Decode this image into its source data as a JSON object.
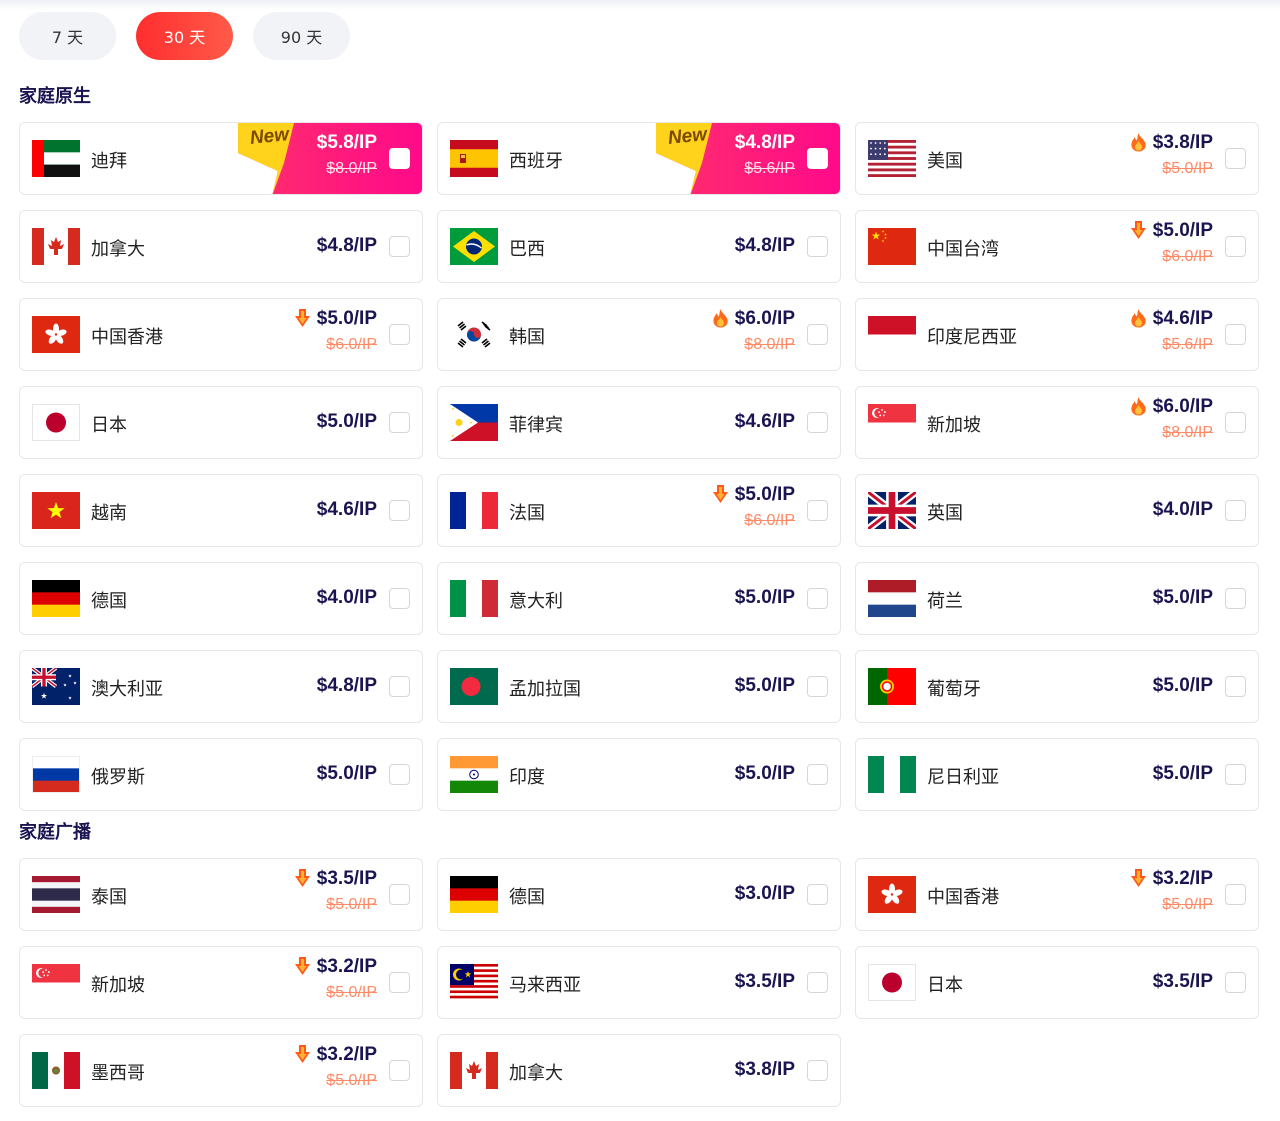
{
  "tabs": [
    {
      "label": "7 天",
      "active": false
    },
    {
      "label": "30 天",
      "active": true
    },
    {
      "label": "90 天",
      "active": false
    }
  ],
  "sections": [
    {
      "title": "家庭原生",
      "items": [
        {
          "flag": "ae",
          "country": "迪拜",
          "price": "$5.8/IP",
          "old_price": "$8.0/IP",
          "badge": "New",
          "selected": true
        },
        {
          "flag": "es",
          "country": "西班牙",
          "price": "$4.8/IP",
          "old_price": "$5.6/IP",
          "badge": "New",
          "selected": true
        },
        {
          "flag": "us",
          "country": "美国",
          "price": "$3.8/IP",
          "old_price": "$5.0/IP",
          "icon": "fire-icon"
        },
        {
          "flag": "ca",
          "country": "加拿大",
          "price": "$4.8/IP"
        },
        {
          "flag": "br",
          "country": "巴西",
          "price": "$4.8/IP"
        },
        {
          "flag": "tw",
          "country": "中国台湾",
          "price": "$5.0/IP",
          "old_price": "$6.0/IP",
          "icon": "price-drop-icon"
        },
        {
          "flag": "hk",
          "country": "中国香港",
          "price": "$5.0/IP",
          "old_price": "$6.0/IP",
          "icon": "price-drop-icon"
        },
        {
          "flag": "kr",
          "country": "韩国",
          "price": "$6.0/IP",
          "old_price": "$8.0/IP",
          "icon": "fire-icon"
        },
        {
          "flag": "id",
          "country": "印度尼西亚",
          "price": "$4.6/IP",
          "old_price": "$5.6/IP",
          "icon": "fire-icon"
        },
        {
          "flag": "jp",
          "country": "日本",
          "price": "$5.0/IP"
        },
        {
          "flag": "ph",
          "country": "菲律宾",
          "price": "$4.6/IP"
        },
        {
          "flag": "sg",
          "country": "新加坡",
          "price": "$6.0/IP",
          "old_price": "$8.0/IP",
          "icon": "fire-icon"
        },
        {
          "flag": "vn",
          "country": "越南",
          "price": "$4.6/IP"
        },
        {
          "flag": "fr",
          "country": "法国",
          "price": "$5.0/IP",
          "old_price": "$6.0/IP",
          "icon": "price-drop-icon"
        },
        {
          "flag": "gb",
          "country": "英国",
          "price": "$4.0/IP"
        },
        {
          "flag": "de",
          "country": "德国",
          "price": "$4.0/IP"
        },
        {
          "flag": "it",
          "country": "意大利",
          "price": "$5.0/IP"
        },
        {
          "flag": "nl",
          "country": "荷兰",
          "price": "$5.0/IP"
        },
        {
          "flag": "au",
          "country": "澳大利亚",
          "price": "$4.8/IP"
        },
        {
          "flag": "bd",
          "country": "孟加拉国",
          "price": "$5.0/IP"
        },
        {
          "flag": "pt",
          "country": "葡萄牙",
          "price": "$5.0/IP"
        },
        {
          "flag": "ru",
          "country": "俄罗斯",
          "price": "$5.0/IP"
        },
        {
          "flag": "in",
          "country": "印度",
          "price": "$5.0/IP"
        },
        {
          "flag": "ng",
          "country": "尼日利亚",
          "price": "$5.0/IP"
        }
      ]
    },
    {
      "title": "家庭广播",
      "items": [
        {
          "flag": "th",
          "country": "泰国",
          "price": "$3.5/IP",
          "old_price": "$5.0/IP",
          "icon": "price-drop-icon"
        },
        {
          "flag": "de",
          "country": "德国",
          "price": "$3.0/IP"
        },
        {
          "flag": "hk",
          "country": "中国香港",
          "price": "$3.2/IP",
          "old_price": "$5.0/IP",
          "icon": "price-drop-icon"
        },
        {
          "flag": "sg",
          "country": "新加坡",
          "price": "$3.2/IP",
          "old_price": "$5.0/IP",
          "icon": "price-drop-icon"
        },
        {
          "flag": "my",
          "country": "马来西亚",
          "price": "$3.5/IP"
        },
        {
          "flag": "jp",
          "country": "日本",
          "price": "$3.5/IP"
        },
        {
          "flag": "mx",
          "country": "墨西哥",
          "price": "$3.2/IP",
          "old_price": "$5.0/IP",
          "icon": "price-drop-icon"
        },
        {
          "flag": "ca",
          "country": "加拿大",
          "price": "$3.8/IP"
        }
      ]
    }
  ],
  "colors": {
    "accent": "#ff3b3b",
    "navy": "#1a1450",
    "old_price": "#ff8a66",
    "promo_gradient": [
      "#ff2f6b",
      "#ff0a8a"
    ],
    "new_badge": "#ffd21c"
  }
}
